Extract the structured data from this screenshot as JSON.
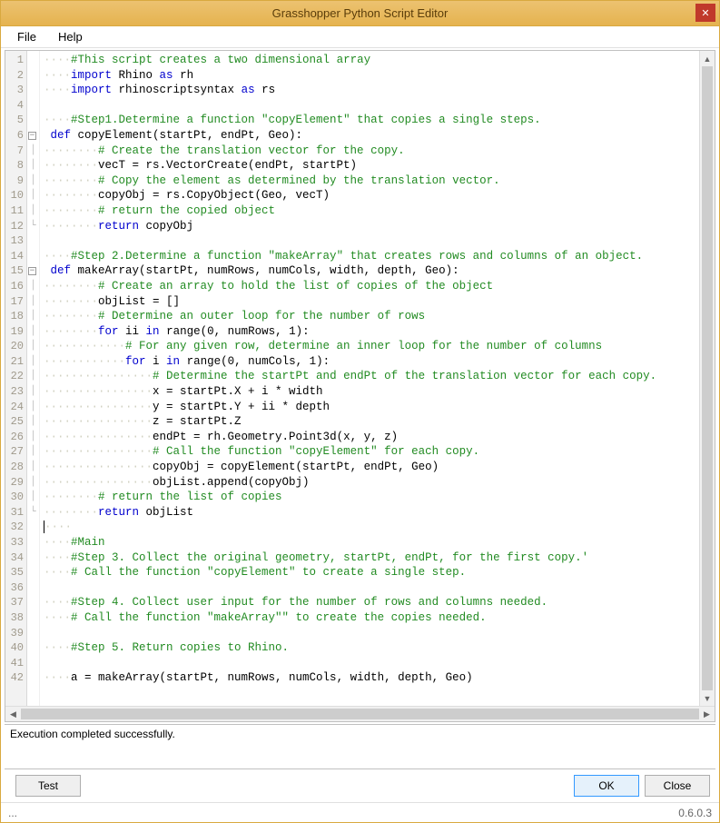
{
  "window": {
    "title": "Grasshopper Python Script Editor",
    "close_label": "✕"
  },
  "menu": {
    "file": "File",
    "help": "Help"
  },
  "code_lines": [
    {
      "n": 1,
      "fold": "",
      "tokens": [
        {
          "t": "ws",
          "s": "····"
        },
        {
          "t": "cm",
          "s": "#This script creates a two dimensional array"
        }
      ]
    },
    {
      "n": 2,
      "fold": "",
      "tokens": [
        {
          "t": "ws",
          "s": "····"
        },
        {
          "t": "kw",
          "s": "import"
        },
        {
          "t": "nm",
          "s": " Rhino "
        },
        {
          "t": "kw",
          "s": "as"
        },
        {
          "t": "nm",
          "s": " rh"
        }
      ]
    },
    {
      "n": 3,
      "fold": "",
      "tokens": [
        {
          "t": "ws",
          "s": "····"
        },
        {
          "t": "kw",
          "s": "import"
        },
        {
          "t": "nm",
          "s": " rhinoscriptsyntax "
        },
        {
          "t": "kw",
          "s": "as"
        },
        {
          "t": "nm",
          "s": " rs"
        }
      ]
    },
    {
      "n": 4,
      "fold": "",
      "tokens": []
    },
    {
      "n": 5,
      "fold": "",
      "tokens": [
        {
          "t": "ws",
          "s": "····"
        },
        {
          "t": "cm",
          "s": "#Step1.Determine a function \"copyElement\" that copies a single steps."
        }
      ]
    },
    {
      "n": 6,
      "fold": "box",
      "tokens": [
        {
          "t": "kw",
          "s": " def"
        },
        {
          "t": "nm",
          "s": " copyElement(startPt, endPt, Geo):"
        }
      ]
    },
    {
      "n": 7,
      "fold": "|",
      "tokens": [
        {
          "t": "ws",
          "s": "········"
        },
        {
          "t": "cm",
          "s": "# Create the translation vector for the copy."
        }
      ]
    },
    {
      "n": 8,
      "fold": "|",
      "tokens": [
        {
          "t": "ws",
          "s": "········"
        },
        {
          "t": "nm",
          "s": "vecT = rs.VectorCreate(endPt, startPt)"
        }
      ]
    },
    {
      "n": 9,
      "fold": "|",
      "tokens": [
        {
          "t": "ws",
          "s": "········"
        },
        {
          "t": "cm",
          "s": "# Copy the element as determined by the translation vector."
        }
      ]
    },
    {
      "n": 10,
      "fold": "|",
      "tokens": [
        {
          "t": "ws",
          "s": "········"
        },
        {
          "t": "nm",
          "s": "copyObj = rs.CopyObject(Geo, vecT)"
        }
      ]
    },
    {
      "n": 11,
      "fold": "|",
      "tokens": [
        {
          "t": "ws",
          "s": "········"
        },
        {
          "t": "cm",
          "s": "# return the copied object"
        }
      ]
    },
    {
      "n": 12,
      "fold": "L",
      "tokens": [
        {
          "t": "ws",
          "s": "········"
        },
        {
          "t": "kw",
          "s": "return"
        },
        {
          "t": "nm",
          "s": " copyObj"
        }
      ]
    },
    {
      "n": 13,
      "fold": "",
      "tokens": []
    },
    {
      "n": 14,
      "fold": "",
      "tokens": [
        {
          "t": "ws",
          "s": "····"
        },
        {
          "t": "cm",
          "s": "#Step 2.Determine a function \"makeArray\" that creates rows and columns of an object."
        }
      ]
    },
    {
      "n": 15,
      "fold": "box",
      "tokens": [
        {
          "t": "kw",
          "s": " def"
        },
        {
          "t": "nm",
          "s": " makeArray(startPt, numRows, numCols, width, depth, Geo):"
        }
      ]
    },
    {
      "n": 16,
      "fold": "|",
      "tokens": [
        {
          "t": "ws",
          "s": "········"
        },
        {
          "t": "cm",
          "s": "# Create an array to hold the list of copies of the object"
        }
      ]
    },
    {
      "n": 17,
      "fold": "|",
      "tokens": [
        {
          "t": "ws",
          "s": "········"
        },
        {
          "t": "nm",
          "s": "objList = []"
        }
      ]
    },
    {
      "n": 18,
      "fold": "|",
      "tokens": [
        {
          "t": "ws",
          "s": "········"
        },
        {
          "t": "cm",
          "s": "# Determine an outer loop for the number of rows"
        }
      ]
    },
    {
      "n": 19,
      "fold": "|",
      "tokens": [
        {
          "t": "ws",
          "s": "········"
        },
        {
          "t": "kw",
          "s": "for"
        },
        {
          "t": "nm",
          "s": " ii "
        },
        {
          "t": "kw",
          "s": "in"
        },
        {
          "t": "nm",
          "s": " range(0, numRows, 1):"
        }
      ]
    },
    {
      "n": 20,
      "fold": "|",
      "tokens": [
        {
          "t": "ws",
          "s": "············"
        },
        {
          "t": "cm",
          "s": "# For any given row, determine an inner loop for the number of columns"
        }
      ]
    },
    {
      "n": 21,
      "fold": "|",
      "tokens": [
        {
          "t": "ws",
          "s": "············"
        },
        {
          "t": "kw",
          "s": "for"
        },
        {
          "t": "nm",
          "s": " i "
        },
        {
          "t": "kw",
          "s": "in"
        },
        {
          "t": "nm",
          "s": " range(0, numCols, 1):"
        }
      ]
    },
    {
      "n": 22,
      "fold": "|",
      "tokens": [
        {
          "t": "ws",
          "s": "················"
        },
        {
          "t": "cm",
          "s": "# Determine the startPt and endPt of the translation vector for each copy."
        }
      ]
    },
    {
      "n": 23,
      "fold": "|",
      "tokens": [
        {
          "t": "ws",
          "s": "················"
        },
        {
          "t": "nm",
          "s": "x = startPt.X + i * width"
        }
      ]
    },
    {
      "n": 24,
      "fold": "|",
      "tokens": [
        {
          "t": "ws",
          "s": "················"
        },
        {
          "t": "nm",
          "s": "y = startPt.Y + ii * depth"
        }
      ]
    },
    {
      "n": 25,
      "fold": "|",
      "tokens": [
        {
          "t": "ws",
          "s": "················"
        },
        {
          "t": "nm",
          "s": "z = startPt.Z"
        }
      ]
    },
    {
      "n": 26,
      "fold": "|",
      "tokens": [
        {
          "t": "ws",
          "s": "················"
        },
        {
          "t": "nm",
          "s": "endPt = rh.Geometry.Point3d(x, y, z)"
        }
      ]
    },
    {
      "n": 27,
      "fold": "|",
      "tokens": [
        {
          "t": "ws",
          "s": "················"
        },
        {
          "t": "cm",
          "s": "# Call the function \"copyElement\" for each copy."
        }
      ]
    },
    {
      "n": 28,
      "fold": "|",
      "tokens": [
        {
          "t": "ws",
          "s": "················"
        },
        {
          "t": "nm",
          "s": "copyObj = copyElement(startPt, endPt, Geo)"
        }
      ]
    },
    {
      "n": 29,
      "fold": "|",
      "tokens": [
        {
          "t": "ws",
          "s": "················"
        },
        {
          "t": "nm",
          "s": "objList.append(copyObj)"
        }
      ]
    },
    {
      "n": 30,
      "fold": "|",
      "tokens": [
        {
          "t": "ws",
          "s": "········"
        },
        {
          "t": "cm",
          "s": "# return the list of copies"
        }
      ]
    },
    {
      "n": 31,
      "fold": "L",
      "tokens": [
        {
          "t": "ws",
          "s": "········"
        },
        {
          "t": "kw",
          "s": "return"
        },
        {
          "t": "nm",
          "s": " objList"
        }
      ]
    },
    {
      "n": 32,
      "fold": "",
      "cursor": true,
      "tokens": [
        {
          "t": "ws",
          "s": "····"
        }
      ]
    },
    {
      "n": 33,
      "fold": "",
      "tokens": [
        {
          "t": "ws",
          "s": "····"
        },
        {
          "t": "cm",
          "s": "#Main"
        }
      ]
    },
    {
      "n": 34,
      "fold": "",
      "tokens": [
        {
          "t": "ws",
          "s": "····"
        },
        {
          "t": "cm",
          "s": "#Step 3. Collect the original geometry, startPt, endPt, for the first copy.'"
        }
      ]
    },
    {
      "n": 35,
      "fold": "",
      "tokens": [
        {
          "t": "ws",
          "s": "····"
        },
        {
          "t": "cm",
          "s": "# Call the function \"copyElement\" to create a single step."
        }
      ]
    },
    {
      "n": 36,
      "fold": "",
      "tokens": []
    },
    {
      "n": 37,
      "fold": "",
      "tokens": [
        {
          "t": "ws",
          "s": "····"
        },
        {
          "t": "cm",
          "s": "#Step 4. Collect user input for the number of rows and columns needed."
        }
      ]
    },
    {
      "n": 38,
      "fold": "",
      "tokens": [
        {
          "t": "ws",
          "s": "····"
        },
        {
          "t": "cm",
          "s": "# Call the function \"makeArray\"\" to create the copies needed."
        }
      ]
    },
    {
      "n": 39,
      "fold": "",
      "tokens": []
    },
    {
      "n": 40,
      "fold": "",
      "tokens": [
        {
          "t": "ws",
          "s": "····"
        },
        {
          "t": "cm",
          "s": "#Step 5. Return copies to Rhino."
        }
      ]
    },
    {
      "n": 41,
      "fold": "",
      "tokens": []
    },
    {
      "n": 42,
      "fold": "",
      "tokens": [
        {
          "t": "ws",
          "s": "····"
        },
        {
          "t": "nm",
          "s": "a = makeArray(startPt, numRows, numCols, width, depth, Geo)"
        }
      ]
    }
  ],
  "status": "Execution completed successfully.",
  "buttons": {
    "test": "Test",
    "ok": "OK",
    "close": "Close"
  },
  "footer": {
    "left": "...",
    "version": "0.6.0.3"
  }
}
